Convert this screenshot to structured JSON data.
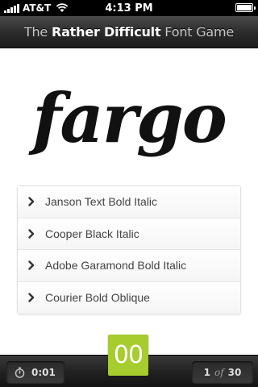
{
  "status_bar": {
    "carrier": "AT&T",
    "time": "4:13 PM"
  },
  "header": {
    "title_parts": [
      "The ",
      "Rather Difficult",
      " Font Game"
    ]
  },
  "specimen": {
    "word": "fargo"
  },
  "answers": [
    {
      "label": "Janson Text Bold Italic"
    },
    {
      "label": "Cooper Black Italic"
    },
    {
      "label": "Adobe Garamond Bold Italic"
    },
    {
      "label": "Courier Bold Oblique"
    }
  ],
  "footer": {
    "timer": "0:01",
    "score": "00",
    "current": "1",
    "of_label": "of",
    "total": "30"
  },
  "colors": {
    "score_tile": "#a6cc2e",
    "header_bar": "#2a2a2a"
  },
  "icons": {
    "answer_bullet": "chevron-right-icon",
    "timer": "stopwatch-icon"
  }
}
